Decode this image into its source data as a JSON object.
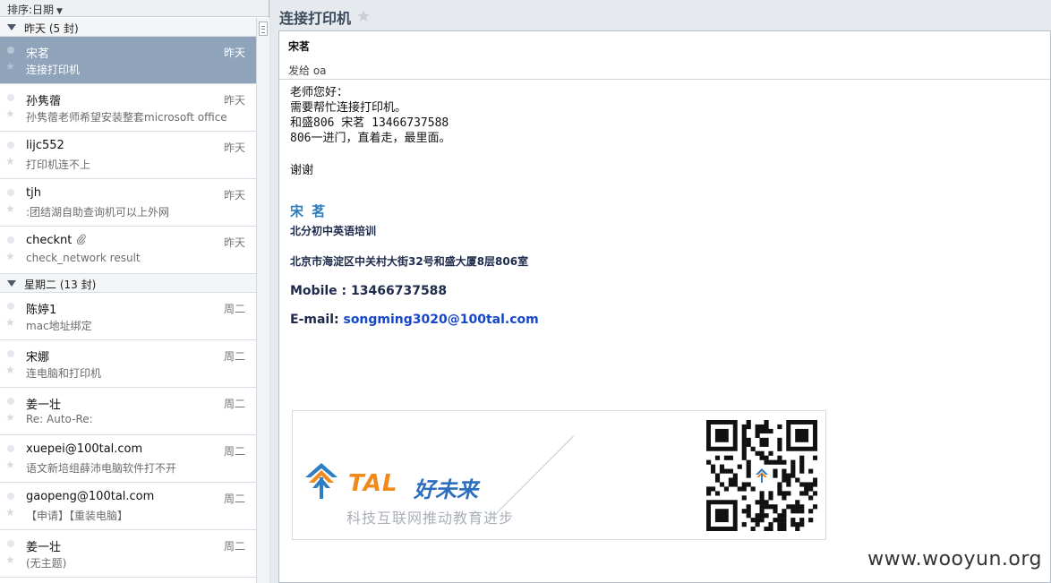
{
  "sort_bar": {
    "label": "排序:日期"
  },
  "groups": [
    {
      "title": "昨天 (5 封)",
      "items": [
        {
          "sender": "宋茗",
          "date": "昨天",
          "subject": "连接打印机",
          "selected": true,
          "attachment": false
        },
        {
          "sender": "孙隽蓿",
          "date": "昨天",
          "subject": "孙隽蓿老师希望安装整套microsoft office",
          "selected": false,
          "attachment": false
        },
        {
          "sender": "lijc552",
          "date": "昨天",
          "subject": "打印机连不上",
          "selected": false,
          "attachment": false
        },
        {
          "sender": "tjh",
          "date": "昨天",
          "subject": ":团结湖自助查询机可以上外网",
          "selected": false,
          "attachment": false
        },
        {
          "sender": "checknt",
          "date": "昨天",
          "subject": "check_network result",
          "selected": false,
          "attachment": true
        }
      ]
    },
    {
      "title": "星期二 (13 封)",
      "items": [
        {
          "sender": "陈婷1",
          "date": "周二",
          "subject": "mac地址绑定",
          "selected": false,
          "attachment": false
        },
        {
          "sender": "宋娜",
          "date": "周二",
          "subject": "连电脑和打印机",
          "selected": false,
          "attachment": false
        },
        {
          "sender": "姜一壮",
          "date": "周二",
          "subject": "Re: Auto-Re:",
          "selected": false,
          "attachment": false
        },
        {
          "sender": "xuepei@100tal.com",
          "date": "周二",
          "subject": "语文新培组薛沛电脑软件打不开",
          "selected": false,
          "attachment": false
        },
        {
          "sender": "gaopeng@100tal.com",
          "date": "周二",
          "subject": "【申请】【重装电脑】",
          "selected": false,
          "attachment": false
        },
        {
          "sender": "姜一壮",
          "date": "周二",
          "subject": "(无主题)",
          "selected": false,
          "attachment": false
        }
      ]
    }
  ],
  "message": {
    "title": "连接打印机",
    "from": "宋茗",
    "to": "发给 oa",
    "body_lines": [
      "老师您好：",
      "需要帮忙连接打印机。",
      "和盛806 宋茗 13466737588",
      "806一进门，直着走，最里面。"
    ],
    "thanks": "谢谢",
    "signature": {
      "name": "宋 茗",
      "dept": "北分初中英语培训",
      "address": "北京市海淀区中关村大街32号和盛大厦8层806室",
      "mobile": "Mobile : 13466737588",
      "email_label": "E-mail: ",
      "email": "songming3020@100tal.com"
    },
    "banner": {
      "logo": "TAL",
      "logo_cn": "好未来",
      "tagline": "科技互联网推动教育进步"
    }
  },
  "watermark": "www.wooyun.org",
  "colors": {
    "selected_row": "#8fa4bb",
    "signature_name": "#2b7bbf",
    "email_link": "#1747c9",
    "logo_orange": "#f08a1c",
    "logo_blue": "#2d6fbf"
  }
}
